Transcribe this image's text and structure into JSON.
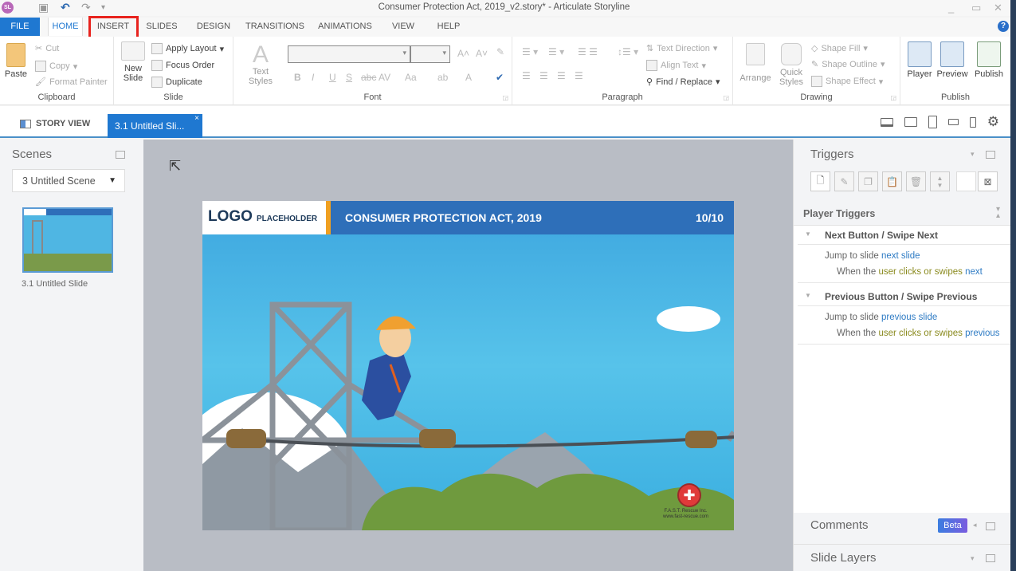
{
  "app": {
    "badge": "SL",
    "title": "Consumer Protection Act, 2019_v2.story* - Articulate Storyline",
    "window_controls": [
      "_",
      "▭",
      "✕"
    ]
  },
  "quick_access": {
    "save_icon": "▣",
    "undo_icon": "↶",
    "redo_icon": "↷",
    "customize_icon": "▾"
  },
  "ribbon_tabs": [
    {
      "label": "FILE"
    },
    {
      "label": "HOME"
    },
    {
      "label": "INSERT"
    },
    {
      "label": "SLIDES"
    },
    {
      "label": "DESIGN"
    },
    {
      "label": "TRANSITIONS"
    },
    {
      "label": "ANIMATIONS"
    },
    {
      "label": "VIEW"
    },
    {
      "label": "HELP"
    }
  ],
  "active_tab": "HOME",
  "highlighted_tab": "INSERT",
  "help_icon": "?",
  "ribbon": {
    "clipboard": {
      "label": "Clipboard",
      "paste": "Paste",
      "cut": "Cut",
      "copy": "Copy",
      "format_painter": "Format Painter"
    },
    "slide": {
      "label": "Slide",
      "new_slide_1": "New",
      "new_slide_2": "Slide",
      "apply_layout": "Apply Layout",
      "focus_order": "Focus Order",
      "duplicate": "Duplicate"
    },
    "font": {
      "label": "Font",
      "text_styles": "Text Styles",
      "font_name": "",
      "font_size": "",
      "format_buttons": [
        "B",
        "I",
        "U",
        "S",
        "abc",
        "AV",
        "Aa",
        "ab",
        "A"
      ],
      "grow": "A˄",
      "shrink": "A˅"
    },
    "paragraph": {
      "label": "Paragraph",
      "text_direction": "Text Direction",
      "align_text": "Align Text",
      "find_replace": "Find / Replace"
    },
    "drawing": {
      "label": "Drawing",
      "arrange": "Arrange",
      "quick_styles_1": "Quick",
      "quick_styles_2": "Styles",
      "shape_fill": "Shape Fill",
      "shape_outline": "Shape Outline",
      "shape_effect": "Shape Effect"
    },
    "publish": {
      "label": "Publish",
      "player": "Player",
      "preview": "Preview",
      "publish": "Publish"
    }
  },
  "doc_tabs": {
    "story_view": "STORY VIEW",
    "active_slide_tab": "3.1 Untitled Sli...",
    "close": "×",
    "settings_icon": "⚙"
  },
  "scenes": {
    "title": "Scenes",
    "selected_scene": "3 Untitled Scene",
    "slides": [
      {
        "label": "3.1 Untitled Slide"
      }
    ]
  },
  "slide": {
    "logo_main": "LOGO",
    "logo_sub": "PLACEHOLDER",
    "title": "CONSUMER PROTECTION ACT, 2019",
    "page": "10/10",
    "badge_text_1": "F.A.S.T. Rescue Inc.",
    "badge_text_2": "www.fast-rescue.com"
  },
  "triggers": {
    "title": "Triggers",
    "player_triggers_title": "Player Triggers",
    "items": [
      {
        "event": "Next Button / Swipe Next",
        "action_prefix": "Jump to slide",
        "action_target": "next slide",
        "cond_prefix": "When the",
        "cond_user": "user clicks or swipes",
        "cond_target": "next"
      },
      {
        "event": "Previous Button / Swipe Previous",
        "action_prefix": "Jump to slide",
        "action_target": "previous slide",
        "cond_prefix": "When the",
        "cond_user": "user clicks or swipes",
        "cond_target": "previous"
      }
    ]
  },
  "comments": {
    "title": "Comments",
    "badge": "Beta"
  },
  "slide_layers": {
    "title": "Slide Layers"
  },
  "colors": {
    "accent": "#1f78d1",
    "highlight": "#e8231e",
    "slide_header": "#2e6fb9",
    "logo_bar": "#f0a020"
  }
}
